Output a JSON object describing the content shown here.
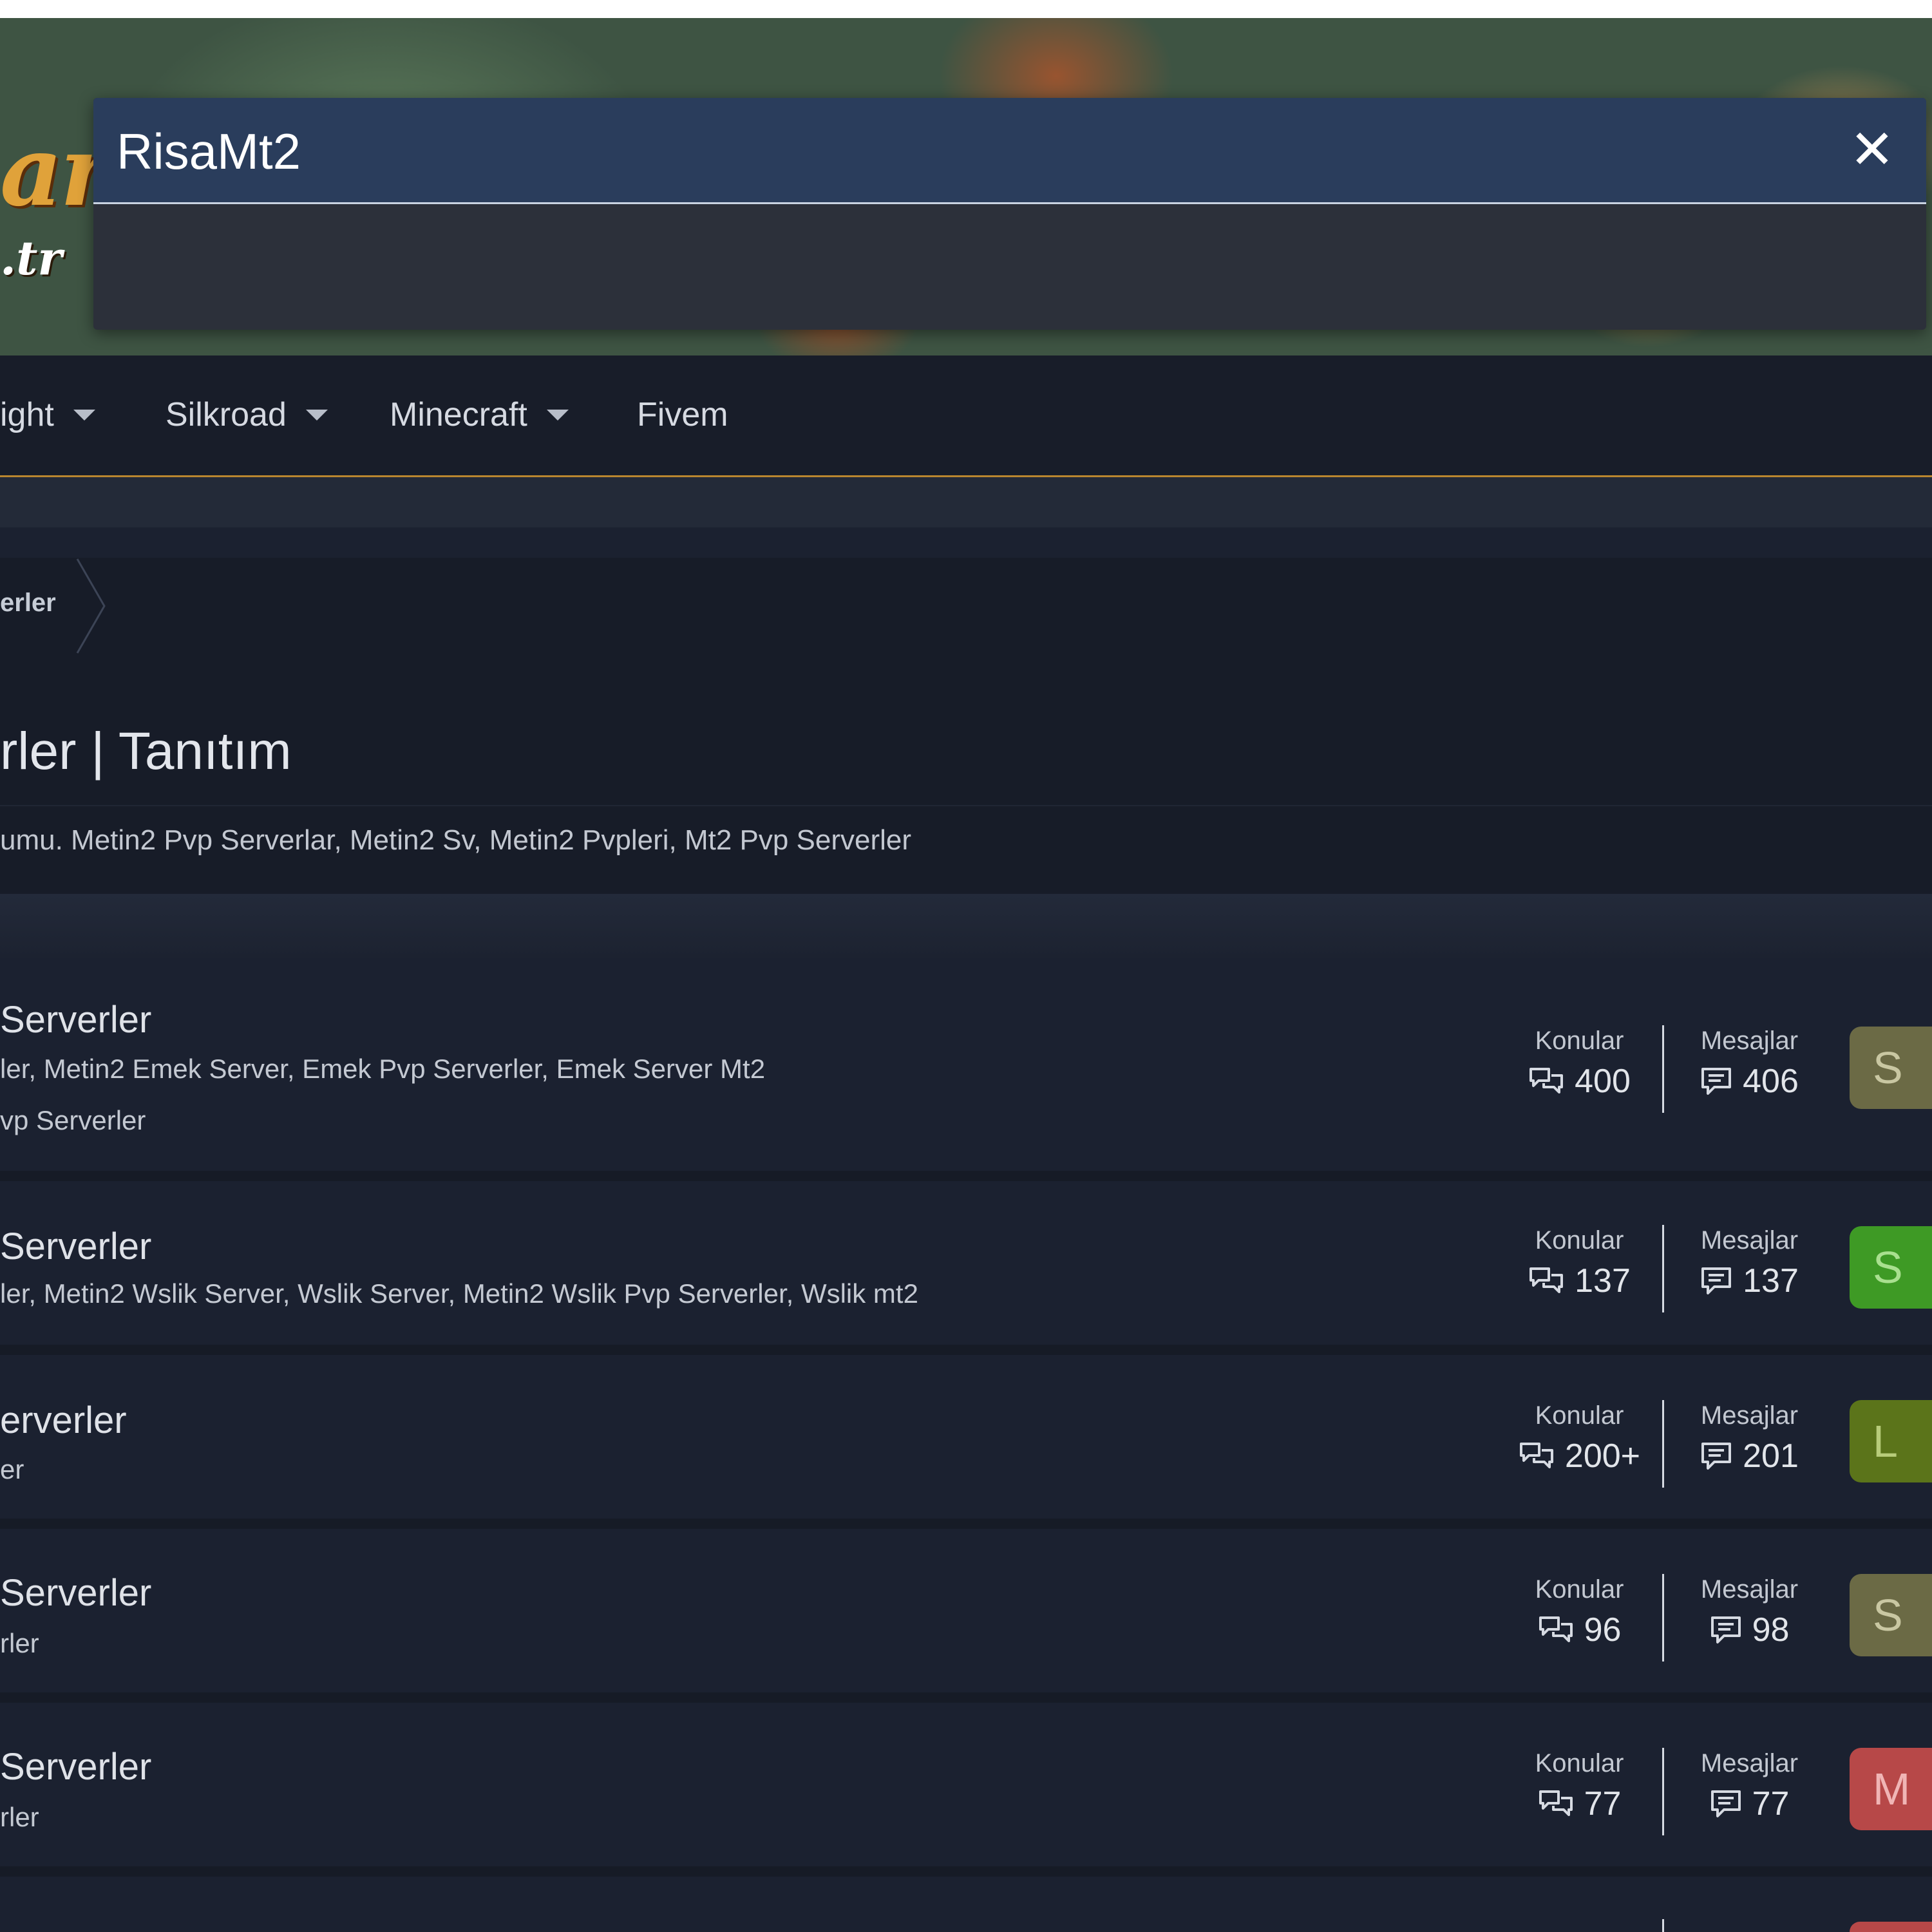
{
  "search": {
    "title": "RisaMt2",
    "close_icon": "close-icon",
    "close_glyph": "✕"
  },
  "logo": {
    "text": "ar",
    "sub": ".tr"
  },
  "nav": {
    "items": [
      {
        "label": "ight",
        "has_dropdown": true
      },
      {
        "label": "Silkroad",
        "has_dropdown": true
      },
      {
        "label": "Minecraft",
        "has_dropdown": true
      },
      {
        "label": "Fivem",
        "has_dropdown": false
      }
    ],
    "accent": "#b9862f"
  },
  "breadcrumb": {
    "label": "erler"
  },
  "page": {
    "title": "rler | Tanıtım",
    "description": "umu. Metin2 Pvp Serverlar, Metin2 Sv, Metin2 Pvpleri, Mt2 Pvp Serverler"
  },
  "stats_labels": {
    "threads": "Konular",
    "messages": "Mesajlar",
    "threads_icon": "chat-bubbles-icon",
    "messages_icon": "message-icon"
  },
  "nodes": [
    {
      "title": "Serverler",
      "desc1": "ler, Metin2 Emek Server, Emek Pvp Serverler, Emek Server Mt2",
      "desc2": "vp Serverler",
      "threads": "400",
      "messages": "406",
      "avatar_letter": "S",
      "avatar_bg": "#6b6a45",
      "avatar_fg": "#c9c7a2"
    },
    {
      "title": "Serverler",
      "desc1": "ler, Metin2 Wslik Server, Wslik Server, Metin2 Wslik Pvp Serverler, Wslik mt2",
      "desc2": "",
      "threads": "137",
      "messages": "137",
      "avatar_letter": "S",
      "avatar_bg": "#3e9a25",
      "avatar_fg": "#a9e08f"
    },
    {
      "title": "erverler",
      "desc1": "er",
      "desc2": "",
      "threads": "200+",
      "messages": "201",
      "avatar_letter": "L",
      "avatar_bg": "#5b741a",
      "avatar_fg": "#b8cc7a"
    },
    {
      "title": "Serverler",
      "desc1": "rler",
      "desc2": "",
      "threads": "96",
      "messages": "98",
      "avatar_letter": "S",
      "avatar_bg": "#6b6a45",
      "avatar_fg": "#c9c7a2"
    },
    {
      "title": "Serverler",
      "desc1": "rler",
      "desc2": "",
      "threads": "77",
      "messages": "77",
      "avatar_letter": "M",
      "avatar_bg": "#b74848",
      "avatar_fg": "#f0b5b5"
    }
  ]
}
